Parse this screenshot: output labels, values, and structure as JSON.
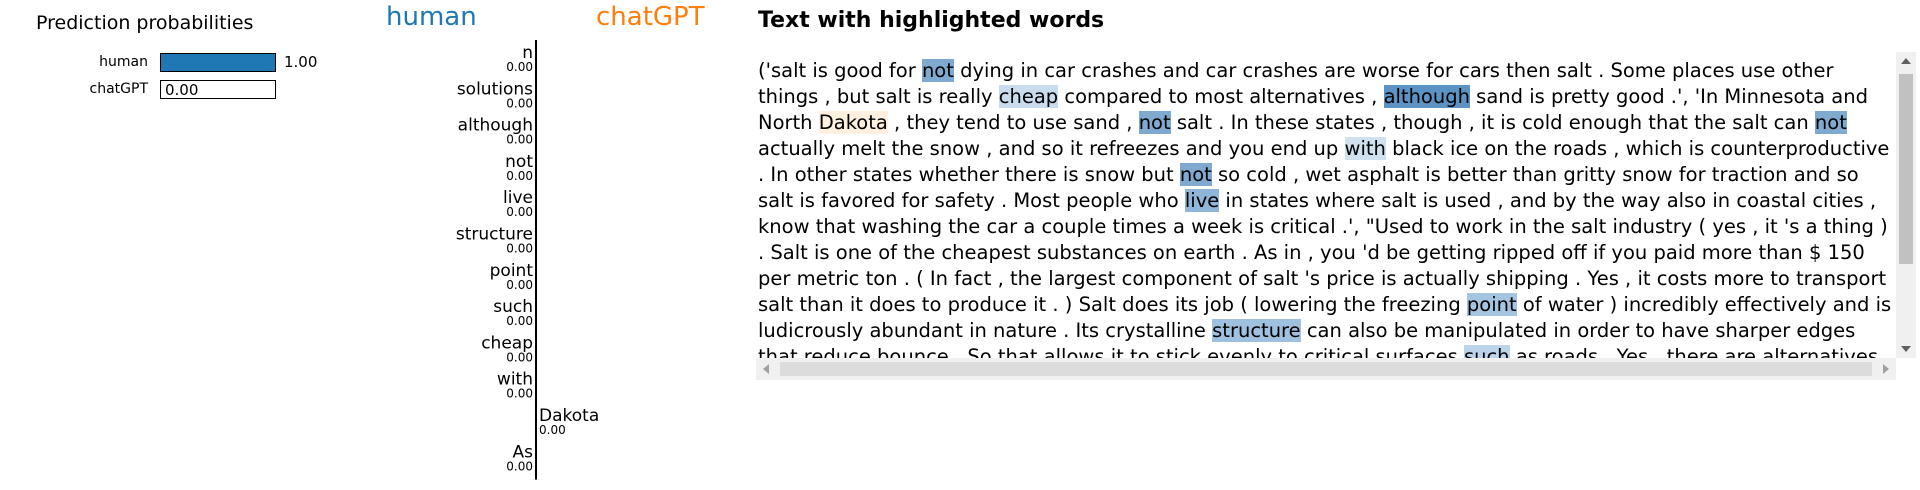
{
  "prediction": {
    "title": "Prediction probabilities",
    "classes": [
      {
        "label": "human",
        "probability": 1.0,
        "display": "1.00",
        "color": "#1f77b4"
      },
      {
        "label": "chatGPT",
        "probability": 0.0,
        "display": "0.00",
        "color": "#ff7f0e"
      }
    ]
  },
  "chart_data": {
    "type": "bar",
    "orientation": "horizontal",
    "class_headers": {
      "left": "human",
      "right": "chatGPT"
    },
    "colors": {
      "left": "#1f77b4",
      "right": "#ff7f0e"
    },
    "features": [
      {
        "word": "n",
        "value": "0.00",
        "side": "left"
      },
      {
        "word": "solutions",
        "value": "0.00",
        "side": "left"
      },
      {
        "word": "although",
        "value": "0.00",
        "side": "left"
      },
      {
        "word": "not",
        "value": "0.00",
        "side": "left"
      },
      {
        "word": "live",
        "value": "0.00",
        "side": "left"
      },
      {
        "word": "structure",
        "value": "0.00",
        "side": "left"
      },
      {
        "word": "point",
        "value": "0.00",
        "side": "left"
      },
      {
        "word": "such",
        "value": "0.00",
        "side": "left"
      },
      {
        "word": "cheap",
        "value": "0.00",
        "side": "left"
      },
      {
        "word": "with",
        "value": "0.00",
        "side": "left"
      },
      {
        "word": "Dakota",
        "value": "0.00",
        "side": "right"
      },
      {
        "word": "As",
        "value": "0.00",
        "side": "left"
      }
    ]
  },
  "text_panel": {
    "title": "Text with highlighted words",
    "segments": [
      {
        "t": "('salt is good for "
      },
      {
        "t": "not",
        "hl": "#7fa9cf"
      },
      {
        "t": " dying in car crashes and car crashes are worse for cars then salt . Some places use other things , but salt is really "
      },
      {
        "t": "cheap",
        "hl": "#c8dcee"
      },
      {
        "t": " compared to most alternatives , "
      },
      {
        "t": "although",
        "hl": "#5b93c4"
      },
      {
        "t": " sand is pretty good .', 'In Minnesota and North "
      },
      {
        "t": "Dakota",
        "hl": "#fff0e0"
      },
      {
        "t": " , they tend to use sand , "
      },
      {
        "t": "not",
        "hl": "#7fa9cf"
      },
      {
        "t": " salt . In these states , though , it is cold enough that the salt can "
      },
      {
        "t": "not",
        "hl": "#7fa9cf"
      },
      {
        "t": " actually melt the snow , and so it refreezes and you end up "
      },
      {
        "t": "with",
        "hl": "#cfe0ef"
      },
      {
        "t": " black ice on the roads , which is counterproductive . In other states whether there is snow but "
      },
      {
        "t": "not",
        "hl": "#7fa9cf"
      },
      {
        "t": " so cold , wet asphalt is better than gritty snow for traction and so salt is favored for safety . Most people who "
      },
      {
        "t": "live",
        "hl": "#8fb5d8"
      },
      {
        "t": " in states where salt is used , and by the way also in coastal cities , know that washing the car a couple times a week is critical .', \"Used to work in the salt industry ( yes , it 's a thing ) . Salt is one of the cheapest substances on earth . As in , you 'd be getting ripped off if you paid more than $ 150 per metric ton . ( In fact , the largest component of salt 's price is actually shipping . Yes , it costs more to transport salt than it does to produce it . ) Salt does its job ( lowering the freezing "
      },
      {
        "t": "point",
        "hl": "#a4c4e0"
      },
      {
        "t": " of water ) incredibly effectively and is ludicrously abundant in nature . Its crystalline "
      },
      {
        "t": "structure",
        "hl": "#9fc0de"
      },
      {
        "t": " can also be manipulated in order to have sharper edges that reduce bounce . So that allows it to stick evenly to critical surfaces "
      },
      {
        "t": "such",
        "hl": "#bcd4ea"
      },
      {
        "t": " as roads . Yes , there are alternatives . Usually salt / gravel mix or sugar beet based solutions"
      }
    ]
  }
}
